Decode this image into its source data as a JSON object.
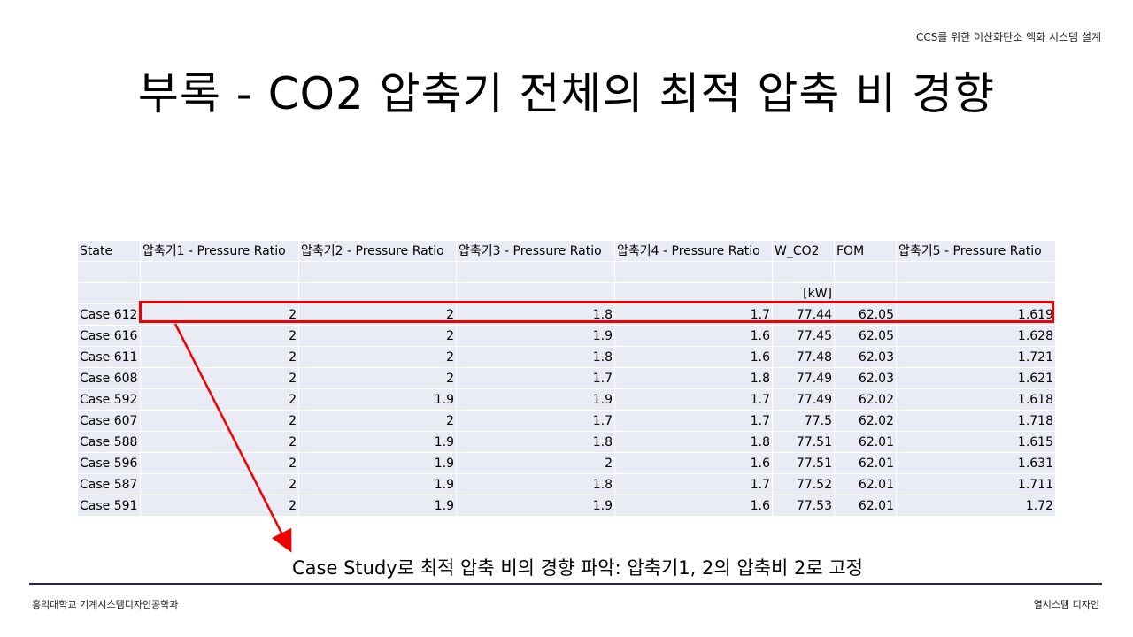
{
  "header_tag": "CCS를 위한 이산화탄소 액화 시스템 설계",
  "title": "부록 - CO2 압축기 전체의 최적 압축 비 경향",
  "table": {
    "headers": [
      "State",
      "압축기1 - Pressure Ratio",
      "압축기2 - Pressure Ratio",
      "압축기3 - Pressure Ratio",
      "압축기4 - Pressure Ratio",
      "W_CO2",
      "FOM",
      "압축기5 - Pressure Ratio"
    ],
    "unit_row": [
      "",
      "",
      "",
      "",
      "",
      "[kW]",
      "",
      ""
    ],
    "rows": [
      [
        "Case 612",
        "2",
        "2",
        "1.8",
        "1.7",
        "77.44",
        "62.05",
        "1.619"
      ],
      [
        "Case 616",
        "2",
        "2",
        "1.9",
        "1.6",
        "77.45",
        "62.05",
        "1.628"
      ],
      [
        "Case 611",
        "2",
        "2",
        "1.8",
        "1.6",
        "77.48",
        "62.03",
        "1.721"
      ],
      [
        "Case 608",
        "2",
        "2",
        "1.7",
        "1.8",
        "77.49",
        "62.03",
        "1.621"
      ],
      [
        "Case 592",
        "2",
        "1.9",
        "1.9",
        "1.7",
        "77.49",
        "62.02",
        "1.618"
      ],
      [
        "Case 607",
        "2",
        "2",
        "1.7",
        "1.7",
        "77.5",
        "62.02",
        "1.718"
      ],
      [
        "Case 588",
        "2",
        "1.9",
        "1.8",
        "1.8",
        "77.51",
        "62.01",
        "1.615"
      ],
      [
        "Case 596",
        "2",
        "1.9",
        "2",
        "1.6",
        "77.51",
        "62.01",
        "1.631"
      ],
      [
        "Case 587",
        "2",
        "1.9",
        "1.8",
        "1.7",
        "77.52",
        "62.01",
        "1.711"
      ],
      [
        "Case 591",
        "2",
        "1.9",
        "1.9",
        "1.6",
        "77.53",
        "62.01",
        "1.72"
      ]
    ]
  },
  "caption": "Case Study로 최적 압축 비의 경향 파악: 압축기1, 2의 압축비 2로 고정",
  "footer": {
    "left": "홍익대학교 기계시스템디자인공학과",
    "right": "열시스템 디자인"
  },
  "colors": {
    "highlight": "#ee0000",
    "table_fill": "#e9ebf5",
    "divider": "#28235e"
  }
}
